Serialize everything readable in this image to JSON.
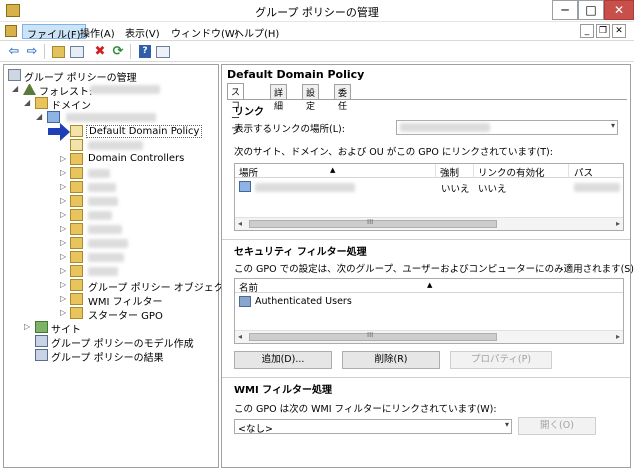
{
  "window": {
    "title": "グループ ポリシーの管理"
  },
  "menu": {
    "items": [
      "ファイル(F)",
      "操作(A)",
      "表示(V)",
      "ウィンドウ(W)",
      "ヘルプ(H)"
    ]
  },
  "window_controls": {
    "minimize": "─",
    "maximize": "□",
    "close": "✕",
    "mdi_min": "_",
    "mdi_restore": "❐",
    "mdi_close": "✕"
  },
  "toolbar": {
    "back": "⇦",
    "forward": "⇨",
    "delete": "✖",
    "refresh": "⟳",
    "help": "?"
  },
  "tree": {
    "root": "グループ ポリシーの管理",
    "forest": "フォレスト:",
    "domains": "ドメイン",
    "selected": "Default Domain Policy",
    "domain_controllers": "Domain Controllers",
    "gpo_objects": "グループ ポリシー オブジェクト",
    "wmi_filters": "WMI フィルター",
    "starter_gpo": "スターター GPO",
    "sites": "サイト",
    "modeling": "グループ ポリシーのモデル作成",
    "results": "グループ ポリシーの結果"
  },
  "details": {
    "title": "Default Domain Policy",
    "tabs": [
      "スコープ",
      "詳細",
      "設定",
      "委任"
    ],
    "links": {
      "heading": "リンク",
      "location_label": "表示するリンクの場所(L):",
      "note": "次のサイト、ドメイン、および OU がこの GPO にリンクされています(T):",
      "columns": [
        "場所",
        "強制",
        "リンクの有効化",
        "パス"
      ],
      "row": {
        "enforced": "いいえ",
        "enabled": "いいえ"
      }
    },
    "security": {
      "heading": "セキュリティ フィルター処理",
      "note": "この GPO での設定は、次のグループ、ユーザーおよびコンピューターにのみ適用されます(S):",
      "column": "名前",
      "rows": [
        "Authenticated Users"
      ],
      "add_button": "追加(D)...",
      "remove_button": "削除(R)",
      "properties_button": "プロパティ(P)"
    },
    "wmi": {
      "heading": "WMI フィルター処理",
      "note": "この GPO は次の WMI フィルターにリンクされています(W):",
      "value": "<なし>",
      "open_button": "開く(O)"
    }
  },
  "scroll": {
    "left": "◂",
    "right": "▸",
    "grip": "III"
  },
  "glyphs": {
    "expanded": "◢",
    "collapsed": "▷",
    "sort": "▲",
    "dropdown": "▾"
  }
}
